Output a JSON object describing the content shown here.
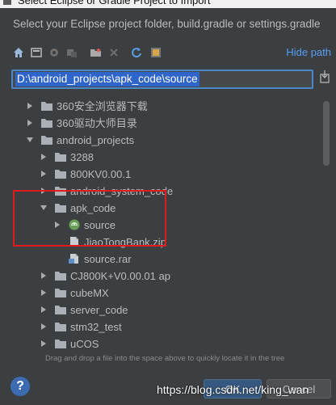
{
  "window": {
    "title": "Select Eclipse or Gradle Project to Import",
    "subtitle": "Select your Eclipse project folder, build.gradle or settings.gradle"
  },
  "toolbar": {
    "icons": [
      "home-icon",
      "desktop-icon",
      "project-icon",
      "module-icon",
      "new-folder-icon",
      "delete-icon",
      "refresh-icon",
      "show-hidden-icon"
    ],
    "hide_path_label": "Hide path"
  },
  "path": {
    "value": "D:\\android_projects\\apk_code\\source"
  },
  "tree": {
    "items": [
      {
        "label": "360安全浏览器下载",
        "depth": 1,
        "expanded": false,
        "type": "folder"
      },
      {
        "label": "360驱动大师目录",
        "depth": 1,
        "expanded": false,
        "type": "folder"
      },
      {
        "label": "android_projects",
        "depth": 1,
        "expanded": true,
        "type": "folder"
      },
      {
        "label": "3288",
        "depth": 2,
        "expanded": false,
        "type": "folder"
      },
      {
        "label": "800KV0.00.1",
        "depth": 2,
        "expanded": false,
        "type": "folder"
      },
      {
        "label": "android_system_code",
        "depth": 2,
        "expanded": false,
        "type": "folder"
      },
      {
        "label": "apk_code",
        "depth": 2,
        "expanded": true,
        "type": "folder"
      },
      {
        "label": "source",
        "depth": 3,
        "expanded": false,
        "type": "android-project"
      },
      {
        "label": "JiaoTongBank.zip",
        "depth": 3,
        "expanded": null,
        "type": "file"
      },
      {
        "label": "source.rar",
        "depth": 3,
        "expanded": null,
        "type": "file"
      },
      {
        "label": "CJ800K+V0.00.01 ap",
        "depth": 2,
        "expanded": false,
        "type": "folder"
      },
      {
        "label": "cubeMX",
        "depth": 2,
        "expanded": false,
        "type": "folder"
      },
      {
        "label": "server_code",
        "depth": 2,
        "expanded": false,
        "type": "folder"
      },
      {
        "label": "stm32_test",
        "depth": 2,
        "expanded": false,
        "type": "folder"
      },
      {
        "label": "uCOS",
        "depth": 2,
        "expanded": false,
        "type": "folder"
      }
    ]
  },
  "hint": "Drag and drop a file into the space above to quickly locate it in the tree",
  "buttons": {
    "help": "?",
    "ok": "OK",
    "cancel": "Cancel"
  },
  "watermark": "https://blog.csdn.net/king_wan",
  "colors": {
    "background": "#3c3f41",
    "accent": "#589df6",
    "selection": "#2f65ca",
    "highlight_box": "#e01b1b"
  }
}
